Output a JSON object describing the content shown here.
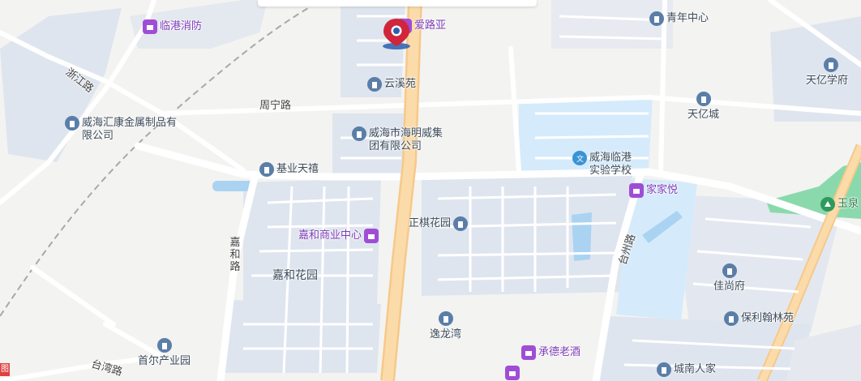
{
  "map": {
    "colors": {
      "background": "#f3f3f1",
      "block": "#dde4ef",
      "water": "#aad3f2",
      "school": "#d8ecfb",
      "park": "#8ad9ad",
      "major_road": "#f8d9a0",
      "road": "#ffffff",
      "railway": "#9a9a9a"
    },
    "pin": {
      "name": "location-marker",
      "color": "#d0253a"
    },
    "roads": {
      "zhejiang": "浙江路",
      "zhouning": "周宁路",
      "jiahe": "嘉和路",
      "taiwan_a": "台湾路",
      "taiwan_b": "台州路"
    },
    "pois": {
      "linfang": "临港消防",
      "ailuya": "爱路亚",
      "qingnian": "青年中心",
      "yunxi": "云溪苑",
      "tianyi_school": "天亿学府",
      "tianyi_city": "天亿城",
      "huikang": "威海汇康金属制品有限公司",
      "haiming": "威海市海明威集团有限公司",
      "jiye": "基业天禧",
      "lingang_school": "威海临港实验学校",
      "jiajiayue": "家家悦",
      "yuquan": "玉泉",
      "jiahe_center": "嘉和商业中心",
      "zhengqi": "正棋花园",
      "jiahe_garden": "嘉和花园",
      "jiashang": "佳尚府",
      "baoli": "保利翰林苑",
      "yilong": "逸龙湾",
      "haier": "首尔产业园",
      "chengde": "承德老酒",
      "chengnan": "城南人家"
    },
    "edge_mark": "图"
  }
}
